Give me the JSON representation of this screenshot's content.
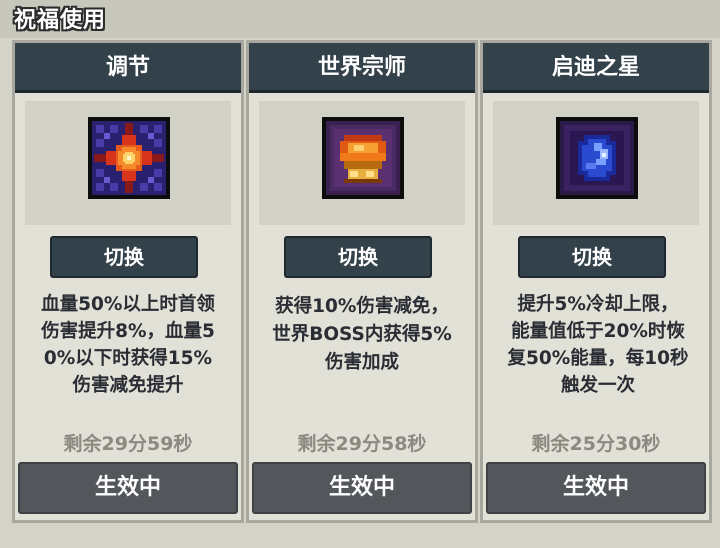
{
  "header": {
    "title": "祝福使用"
  },
  "cards": [
    {
      "title": "调节",
      "icon": "orange-star-rune-icon",
      "switch_label": "切换",
      "description": "血量50%以上时首领\n伤害提升8%，血量5\n0%以下时获得15%\n伤害减免提升",
      "timer": "剩余29分59秒",
      "status": "生效中"
    },
    {
      "title": "世界宗师",
      "icon": "golden-crown-emblem-icon",
      "switch_label": "切换",
      "description": "获得10%伤害减免，\n世界BOSS内获得5%\n伤害加成",
      "timer": "剩余29分58秒",
      "status": "生效中"
    },
    {
      "title": "启迪之星",
      "icon": "blue-crescent-gem-icon",
      "switch_label": "切换",
      "description": "提升5%冷却上限，\n能量值低于20%时恢\n复50%能量，每10秒\n触发一次",
      "timer": "剩余25分30秒",
      "status": "生效中"
    }
  ]
}
